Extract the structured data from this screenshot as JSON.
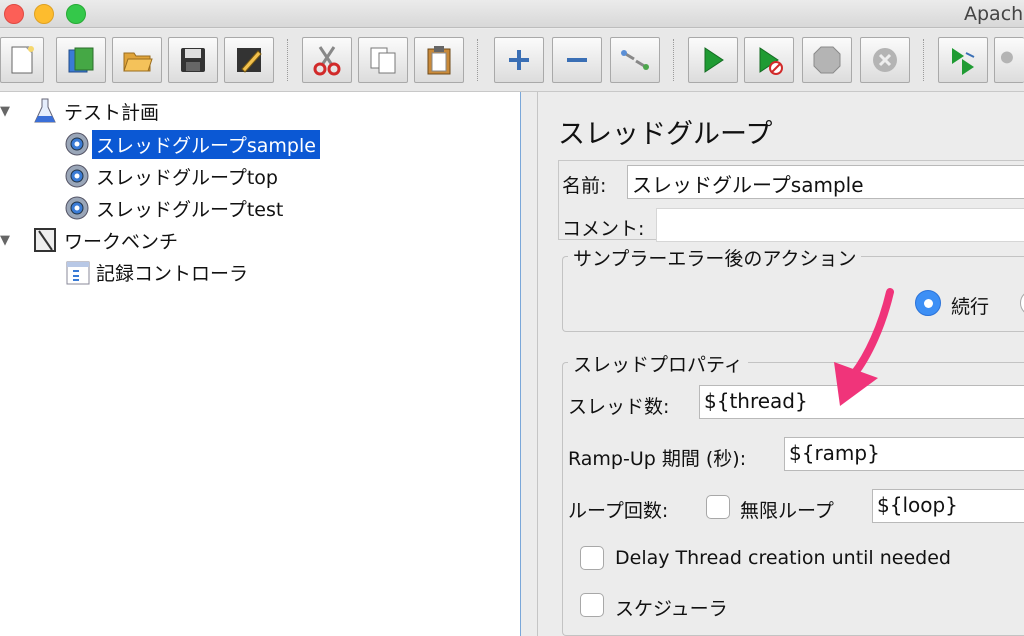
{
  "window": {
    "title": "Apach"
  },
  "toolbar": {
    "buttons": [
      {
        "name": "new-icon"
      },
      {
        "name": "templates-icon"
      },
      {
        "name": "open-icon"
      },
      {
        "name": "save-icon"
      },
      {
        "name": "edit-icon"
      },
      {
        "name": "cut-icon"
      },
      {
        "name": "copy-icon"
      },
      {
        "name": "paste-icon"
      },
      {
        "name": "expand-icon"
      },
      {
        "name": "collapse-icon"
      },
      {
        "name": "toggle-icon"
      },
      {
        "name": "start-icon"
      },
      {
        "name": "start-no-pause-icon"
      },
      {
        "name": "stop-icon"
      },
      {
        "name": "shutdown-icon"
      },
      {
        "name": "remote-start-icon"
      }
    ]
  },
  "tree": {
    "items": [
      {
        "label": "テスト計画",
        "level": 0,
        "expanded": true,
        "icon": "flask-icon"
      },
      {
        "label": "スレッドグループsample",
        "level": 1,
        "selected": true,
        "icon": "gear-icon"
      },
      {
        "label": "スレッドグループtop",
        "level": 1,
        "icon": "gear-icon"
      },
      {
        "label": "スレッドグループtest",
        "level": 1,
        "icon": "gear-icon"
      },
      {
        "label": "ワークベンチ",
        "level": 0,
        "expanded": true,
        "icon": "workbench-icon"
      },
      {
        "label": "記録コントローラ",
        "level": 1,
        "icon": "recorder-icon"
      }
    ]
  },
  "panel": {
    "title": "スレッドグループ",
    "name_label": "名前:",
    "name_value": "スレッドグループsample",
    "comment_label": "コメント:",
    "comment_value": "",
    "sampler_error": {
      "legend": "サンプラーエラー後のアクション",
      "option_continue": "続行",
      "continue_selected": true
    },
    "thread_props": {
      "legend": "スレッドプロパティ",
      "threads_label": "スレッド数:",
      "threads_value": "${thread}",
      "rampup_label": "Ramp-Up 期間 (秒):",
      "rampup_value": "${ramp}",
      "loop_label": "ループ回数:",
      "infinite_label": "無限ループ",
      "infinite_checked": false,
      "loop_value": "${loop}",
      "delay_label": "Delay Thread creation until needed",
      "delay_checked": false,
      "scheduler_label": "スケジューラ",
      "scheduler_checked": false
    }
  },
  "colors": {
    "selection": "#0b58d4",
    "annotation": "#f0347a",
    "radio": "#3d8ff5"
  }
}
